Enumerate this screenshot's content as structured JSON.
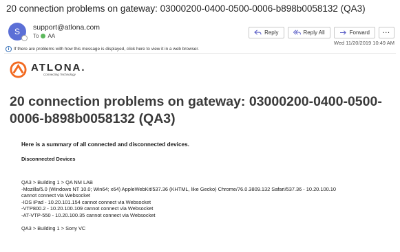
{
  "email": {
    "subject": "20 connection problems on gateway: 03000200-0400-0500-0006-b898b0058132 (QA3)",
    "avatar_initial": "S",
    "sender": "support@atlona.com",
    "to_label": "To",
    "to_recipient": "AA",
    "date": "Wed 11/20/2019 10:49 AM",
    "info_message": "If there are problems with how this message is displayed, click here to view it in a web browser."
  },
  "actions": {
    "reply": "Reply",
    "reply_all": "Reply All",
    "forward": "Forward",
    "more": "···"
  },
  "logo": {
    "word": "ATLONA.",
    "tagline": "Connecting Technology"
  },
  "content": {
    "headline": "20 connection problems on gateway: 03000200-0400-0500-0006-b898b0058132 (QA3)",
    "summary": "Here is a summary of all connected and disconnected devices.",
    "disconnected_title": "Disconnected Devices",
    "group1": {
      "path": "QA3 > Building 1 > QA NM LAB",
      "lines": [
        "-Mozilla/5.0 (Windows NT 10.0; Win64; x64) AppleWebKit/537.36 (KHTML, like Gecko) Chrome/76.0.3809.132 Safari/537.36 - 10.20.100.10",
        "cannot connect via Websocket",
        "-IOS iPad - 10.20.101.154 cannot connect via Websocket",
        "-VTP800.2 - 10.20.100.109 cannot connect via Websocket",
        "-AT-VTP-550 - 10.20.100.35 cannot connect via Websocket"
      ]
    },
    "group2": {
      "path": "QA3 > Building 1 > Sony VC"
    }
  },
  "colors": {
    "avatar": "#5b6fd6",
    "presence_green": "#5cb85c",
    "info_blue": "#2a68b5",
    "logo_orange": "#f26a21"
  }
}
